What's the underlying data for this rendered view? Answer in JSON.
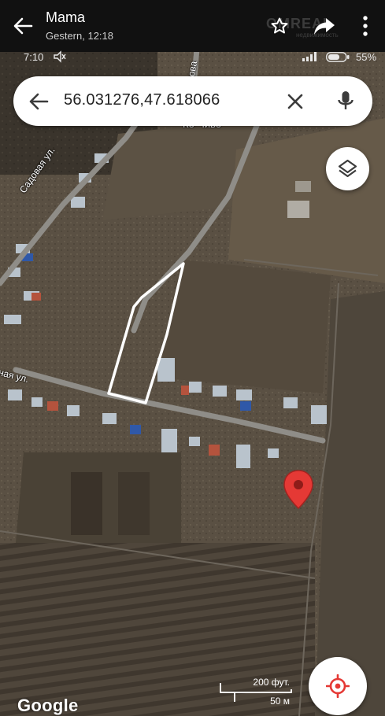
{
  "app_bar": {
    "chat_name": "Mama",
    "chat_time": "Gestern, 12:18",
    "watermark": "OMREAL",
    "watermark_sub": "недвижимость"
  },
  "status_bar": {
    "time": "7:10",
    "battery": "55%"
  },
  "search": {
    "query": "56.031276,47.618066"
  },
  "map": {
    "labels": {
      "street_sadovaya": "Садовая ул.",
      "street_partial": "ная ул.",
      "street_sadova_top": "Садова",
      "poi_partial": "Ко-Чиво"
    },
    "scale_top": "200 фут.",
    "scale_bottom": "50 м",
    "logo": "Google",
    "pin_color": "#e53935",
    "outline_color": "#ffffff",
    "locate_accent": "#e53935"
  },
  "icons": {
    "back": "arrow-left-icon",
    "star": "star-outline-icon",
    "share": "share-icon",
    "more": "more-vertical-icon",
    "clear": "close-icon",
    "mic": "microphone-icon",
    "layers": "layers-icon",
    "locate": "my-location-icon",
    "pin": "map-pin-icon"
  }
}
